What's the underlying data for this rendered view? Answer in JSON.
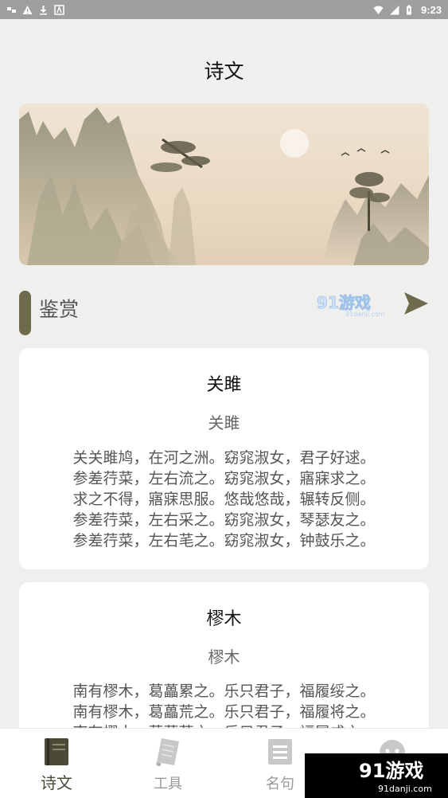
{
  "status_bar": {
    "time": "9:23",
    "left_icons": [
      "notification-icon",
      "warning-icon",
      "download-icon",
      "app-icon"
    ],
    "right_icons": [
      "signal-icon",
      "wifi-icon",
      "battery-icon"
    ]
  },
  "page": {
    "title": "诗文"
  },
  "section": {
    "title": "鉴赏",
    "watermark_text": "91游戏",
    "watermark_sub": "91danji.com"
  },
  "poems": [
    {
      "title": "关雎",
      "subtitle": "关雎",
      "lines": [
        "关关雎鸠，在河之洲。窈窕淑女，君子好逑。",
        "参差荇菜，左右流之。窈窕淑女，寤寐求之。",
        "求之不得，寤寐思服。悠哉悠哉，辗转反侧。",
        "参差荇菜，左右采之。窈窕淑女，琴瑟友之。",
        "参差荇菜，左右芼之。窈窕淑女，钟鼓乐之。"
      ]
    },
    {
      "title": "樛木",
      "subtitle": "樛木",
      "lines": [
        "南有樛木，葛藟累之。乐只君子，福履绥之。",
        "南有樛木，葛藟荒之。乐只君子，福履将之。",
        "南有樛木，葛藟萦之。乐只君子，福履成之。"
      ]
    }
  ],
  "nav": {
    "items": [
      {
        "label": "诗文",
        "icon": "book-icon",
        "active": true
      },
      {
        "label": "工具",
        "icon": "scroll-icon",
        "active": false
      },
      {
        "label": "名句",
        "icon": "list-icon",
        "active": false
      },
      {
        "label": "",
        "icon": "profile-icon",
        "active": false
      }
    ]
  },
  "watermark": {
    "text": "91游戏",
    "sub": "91danji.com"
  },
  "colors": {
    "accent": "#6e6a4c",
    "background": "#efefed",
    "card": "#ffffff"
  }
}
